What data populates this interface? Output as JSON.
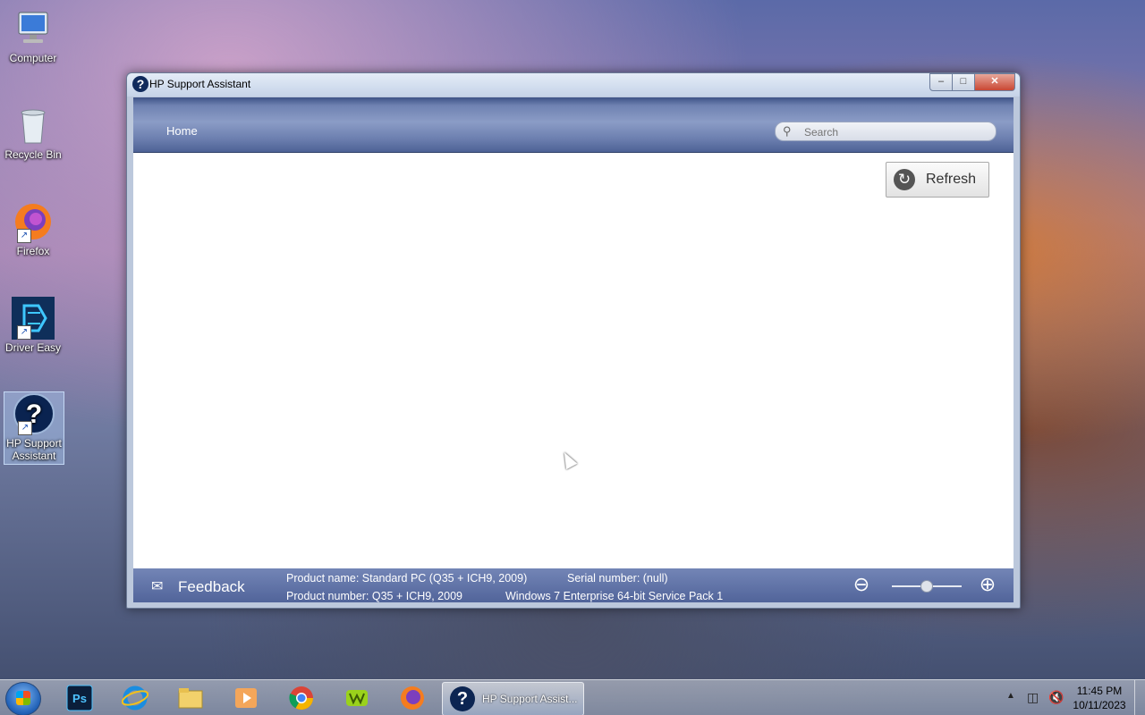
{
  "desktop": {
    "icons": [
      {
        "label": "Computer",
        "icon": "computer-icon"
      },
      {
        "label": "Recycle Bin",
        "icon": "recycle-bin-icon"
      },
      {
        "label": "Firefox",
        "icon": "firefox-icon"
      },
      {
        "label": "Driver Easy",
        "icon": "driver-easy-icon"
      },
      {
        "label": "HP Support Assistant",
        "icon": "hp-support-icon"
      }
    ]
  },
  "window": {
    "title": "HP Support Assistant",
    "controls": {
      "minimize": "–",
      "maximize": "□",
      "close": "✕"
    },
    "nav": {
      "home": "Home"
    },
    "search": {
      "placeholder": "Search",
      "value": ""
    },
    "refresh_label": "Refresh",
    "footer": {
      "feedback_label": "Feedback",
      "product_name": "Product name: Standard PC (Q35 + ICH9, 2009)",
      "serial_number": "Serial number: (null)",
      "product_number": "Product number: Q35 + ICH9, 2009",
      "os": "Windows 7 Enterprise 64-bit Service Pack 1",
      "zoom_level": 0.5
    }
  },
  "taskbar": {
    "pinned": [
      "photoshop-icon",
      "internet-explorer-icon",
      "file-explorer-icon",
      "media-player-icon",
      "chrome-icon",
      "green-app-icon",
      "firefox-icon"
    ],
    "active_window_label": "HP Support Assist...",
    "clock": {
      "time": "11:45 PM",
      "date": "10/11/2023"
    }
  },
  "colors": {
    "header_blue": "#6f82b2",
    "footer_blue": "#5b6ea3"
  }
}
